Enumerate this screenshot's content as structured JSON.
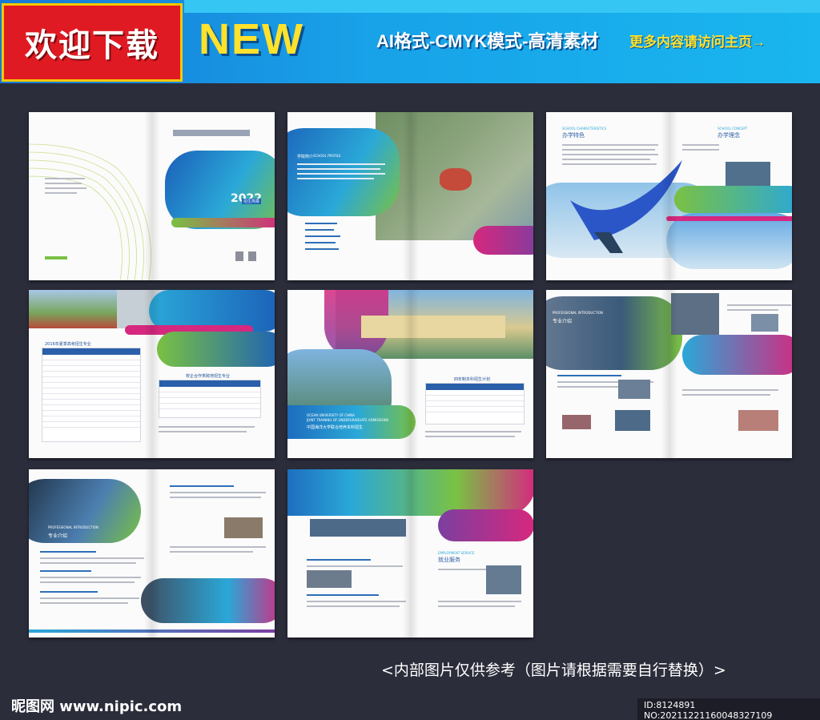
{
  "banner": {
    "welcome": "欢迎下载",
    "new_label": "NEW",
    "format_label": "AI格式-CMYK模式-高清素材",
    "more_label": "更多内容请访问主页→"
  },
  "pages": {
    "cover": {
      "year": "2022",
      "subtitle": "招生简章"
    },
    "profile": {
      "title": "学院简介",
      "title_en": "SCHOOL PROFILE"
    },
    "characteristics": {
      "title_en": "SCHOOL CHARACTERISTICS",
      "title": "办学特色",
      "concept_en": "SCHOOL CONCEPT",
      "concept": "办学理念"
    },
    "plan": {
      "table_title": "2016年夏季高考招生专业",
      "table_title2": "校企合作类跨地招生专业"
    },
    "ocean": {
      "caption_en1": "OCEAN UNIVERSITY OF CHINA",
      "caption_en2": "JOINT TRAINING OF UNDERGRADUATE ADMISSIONS",
      "caption_cn": "中国海洋大学联合培养本科招生",
      "table_title": "四年制本科招生计划"
    },
    "professional": {
      "title_en": "PROFESSIONAL INTRODUCTION",
      "title": "专业介绍"
    },
    "intro": {
      "title_en": "PROFESSIONAL INTRODUCTION",
      "title": "专业介绍"
    },
    "employment": {
      "title_en": "EMPLOYMENT SERVICE",
      "title": "就业服务"
    }
  },
  "footer": {
    "note": "<内部图片仅供参考（图片请根据需要自行替换）>",
    "site_logo": "昵图网 www.nipic.com",
    "id_text": "ID:8124891 NO:20211221160048327109"
  },
  "colors": {
    "brand_blue": "#1e4e96",
    "accent_green": "#7ac143",
    "accent_magenta": "#d6287e",
    "accent_cyan": "#19b6ef"
  }
}
